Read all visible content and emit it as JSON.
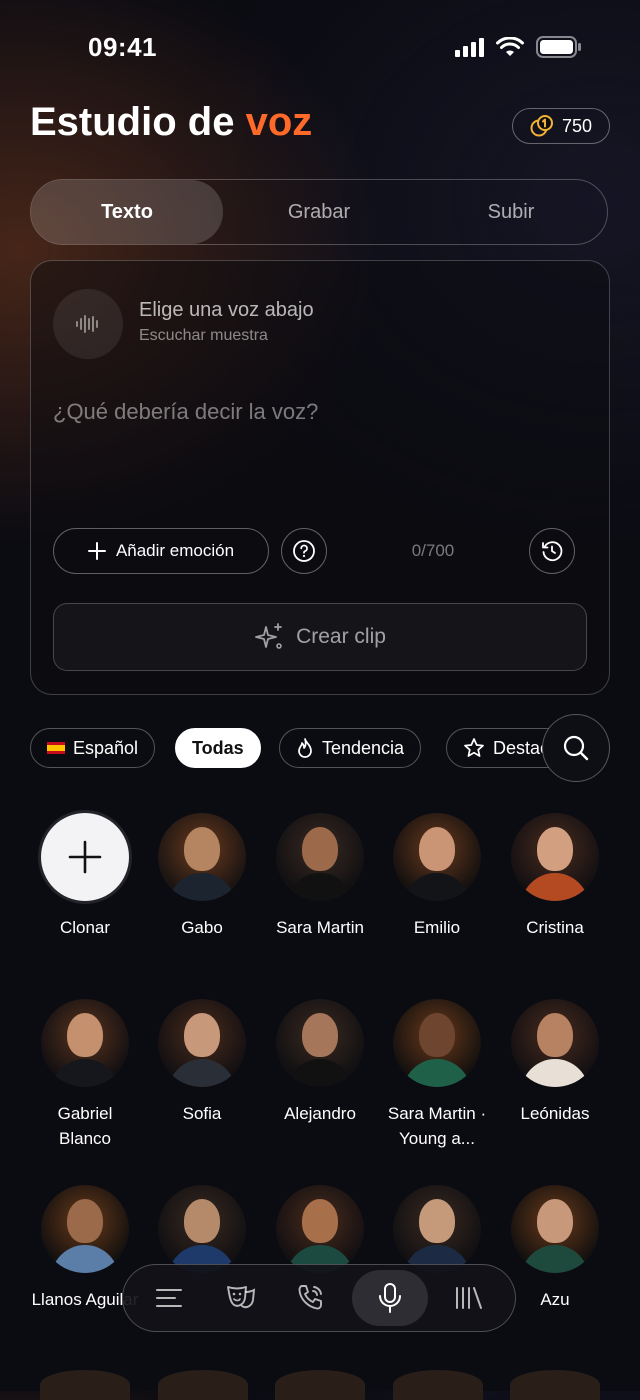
{
  "status": {
    "time": "09:41"
  },
  "header": {
    "title_main": "Estudio de ",
    "title_accent": "voz",
    "credits": "750"
  },
  "tabs": [
    {
      "label": "Texto",
      "active": true
    },
    {
      "label": "Grabar",
      "active": false
    },
    {
      "label": "Subir",
      "active": false
    }
  ],
  "editor": {
    "voice_title": "Elige una voz abajo",
    "voice_subtitle": "Escuchar muestra",
    "placeholder": "¿Qué debería decir la voz?",
    "emotion_label": "Añadir emoción",
    "counter": "0/700",
    "create_label": "Crear clip"
  },
  "filters": [
    {
      "label": "Español",
      "icon": "spain-flag-icon"
    },
    {
      "label": "Todas",
      "active": true
    },
    {
      "label": "Tendencia",
      "icon": "flame-icon"
    },
    {
      "label": "Destacadas",
      "icon": "star-icon"
    }
  ],
  "voices": [
    {
      "name": "Clonar",
      "icon": "plus-icon"
    },
    {
      "name": "Gabo"
    },
    {
      "name": "Sara Martin"
    },
    {
      "name": "Emilio"
    },
    {
      "name": "Cristina"
    },
    {
      "name": "Gabriel Blanco"
    },
    {
      "name": "Sofia"
    },
    {
      "name": "Alejandro"
    },
    {
      "name": "Sara Martin · Young a..."
    },
    {
      "name": "Leónidas"
    },
    {
      "name": "Llanos Aguilar"
    },
    {
      "name": ""
    },
    {
      "name": ""
    },
    {
      "name": ""
    },
    {
      "name": "Azu"
    }
  ],
  "bottom_nav": [
    {
      "icon": "list-icon"
    },
    {
      "icon": "theater-mask-icon"
    },
    {
      "icon": "phone-call-icon"
    },
    {
      "icon": "microphone-icon",
      "active": true
    },
    {
      "icon": "library-icon"
    }
  ],
  "colors": {
    "accent": "#ff6a2b",
    "background": "#0b0b12"
  }
}
